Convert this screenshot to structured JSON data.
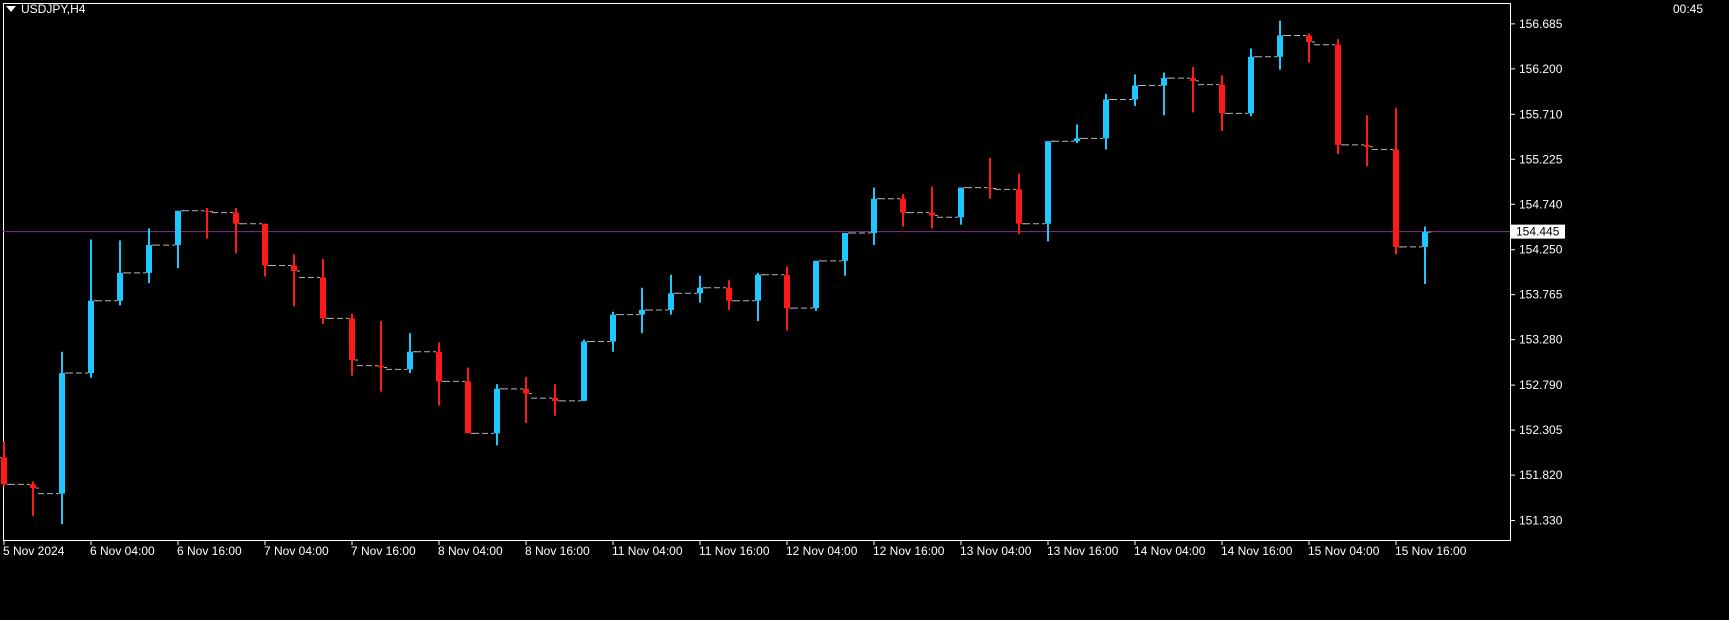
{
  "header": {
    "symbol": "USDJPY,H4",
    "clock": "00:45"
  },
  "colors": {
    "background": "#000000",
    "frame": "#ffffff",
    "bull": "#1ec8ff",
    "bear": "#ff1a1a",
    "bid_line": "#8b2c93",
    "bid_tag_bg": "#ffffff",
    "bid_tag_text": "#000000",
    "open_close_tick": "#b4b4b4"
  },
  "icons": {
    "symbol_menu": "triangle-down-icon"
  },
  "chart_data": {
    "type": "ohlc-candlestick",
    "title": "USDJPY,H4",
    "ylim": [
      151.12,
      156.91
    ],
    "y_ticks": [
      "156.685",
      "156.200",
      "155.710",
      "155.225",
      "154.740",
      "154.250",
      "153.765",
      "153.280",
      "152.790",
      "152.305",
      "151.820",
      "151.330"
    ],
    "x_ticks": [
      "5 Nov 2024",
      "6 Nov 04:00",
      "6 Nov 16:00",
      "7 Nov 04:00",
      "7 Nov 16:00",
      "8 Nov 04:00",
      "8 Nov 16:00",
      "11 Nov 04:00",
      "11 Nov 16:00",
      "12 Nov 04:00",
      "12 Nov 16:00",
      "13 Nov 04:00",
      "13 Nov 16:00",
      "14 Nov 04:00",
      "14 Nov 16:00",
      "15 Nov 04:00",
      "15 Nov 16:00"
    ],
    "current_price": "154.445",
    "current_price_value": 154.445,
    "candles": [
      {
        "o": 152.01,
        "h": 152.18,
        "l": 151.7,
        "c": 151.72
      },
      {
        "o": 151.72,
        "h": 151.75,
        "l": 151.38,
        "c": 151.68
      },
      {
        "o": 151.62,
        "h": 153.15,
        "l": 151.29,
        "c": 152.92
      },
      {
        "o": 152.92,
        "h": 154.36,
        "l": 152.87,
        "c": 153.7
      },
      {
        "o": 153.7,
        "h": 154.35,
        "l": 153.65,
        "c": 154.0
      },
      {
        "o": 154.0,
        "h": 154.48,
        "l": 153.89,
        "c": 154.3
      },
      {
        "o": 154.3,
        "h": 154.67,
        "l": 154.05,
        "c": 154.67
      },
      {
        "o": 154.67,
        "h": 154.7,
        "l": 154.37,
        "c": 154.66
      },
      {
        "o": 154.65,
        "h": 154.7,
        "l": 154.21,
        "c": 154.53
      },
      {
        "o": 154.53,
        "h": 154.53,
        "l": 153.96,
        "c": 154.08
      },
      {
        "o": 154.08,
        "h": 154.2,
        "l": 153.64,
        "c": 154.02
      },
      {
        "o": 153.95,
        "h": 154.15,
        "l": 153.45,
        "c": 153.51
      },
      {
        "o": 153.51,
        "h": 153.56,
        "l": 152.89,
        "c": 153.06
      },
      {
        "o": 153.0,
        "h": 153.48,
        "l": 152.72,
        "c": 152.98
      },
      {
        "o": 152.96,
        "h": 153.35,
        "l": 152.92,
        "c": 153.15
      },
      {
        "o": 153.15,
        "h": 153.25,
        "l": 152.57,
        "c": 152.83
      },
      {
        "o": 152.83,
        "h": 152.98,
        "l": 152.3,
        "c": 152.27
      },
      {
        "o": 152.27,
        "h": 152.8,
        "l": 152.14,
        "c": 152.75
      },
      {
        "o": 152.75,
        "h": 152.88,
        "l": 152.38,
        "c": 152.7
      },
      {
        "o": 152.65,
        "h": 152.8,
        "l": 152.46,
        "c": 152.62
      },
      {
        "o": 152.62,
        "h": 153.28,
        "l": 152.62,
        "c": 153.26
      },
      {
        "o": 153.26,
        "h": 153.58,
        "l": 153.15,
        "c": 153.55
      },
      {
        "o": 153.55,
        "h": 153.84,
        "l": 153.35,
        "c": 153.6
      },
      {
        "o": 153.6,
        "h": 153.98,
        "l": 153.55,
        "c": 153.78
      },
      {
        "o": 153.78,
        "h": 153.97,
        "l": 153.68,
        "c": 153.84
      },
      {
        "o": 153.84,
        "h": 153.92,
        "l": 153.6,
        "c": 153.7
      },
      {
        "o": 153.7,
        "h": 154.0,
        "l": 153.48,
        "c": 153.98
      },
      {
        "o": 153.98,
        "h": 154.07,
        "l": 153.38,
        "c": 153.62
      },
      {
        "o": 153.62,
        "h": 154.13,
        "l": 153.59,
        "c": 154.13
      },
      {
        "o": 154.13,
        "h": 154.4,
        "l": 153.97,
        "c": 154.43
      },
      {
        "o": 154.43,
        "h": 154.92,
        "l": 154.3,
        "c": 154.8
      },
      {
        "o": 154.8,
        "h": 154.85,
        "l": 154.5,
        "c": 154.65
      },
      {
        "o": 154.65,
        "h": 154.93,
        "l": 154.48,
        "c": 154.62
      },
      {
        "o": 154.6,
        "h": 154.92,
        "l": 154.52,
        "c": 154.92
      },
      {
        "o": 154.92,
        "h": 155.24,
        "l": 154.8,
        "c": 154.91
      },
      {
        "o": 154.9,
        "h": 155.07,
        "l": 154.42,
        "c": 154.53
      },
      {
        "o": 154.53,
        "h": 155.42,
        "l": 154.34,
        "c": 155.42
      },
      {
        "o": 155.42,
        "h": 155.6,
        "l": 155.4,
        "c": 155.45
      },
      {
        "o": 155.45,
        "h": 155.93,
        "l": 155.33,
        "c": 155.87
      },
      {
        "o": 155.87,
        "h": 156.14,
        "l": 155.8,
        "c": 156.02
      },
      {
        "o": 156.02,
        "h": 156.16,
        "l": 155.7,
        "c": 156.1
      },
      {
        "o": 156.1,
        "h": 156.22,
        "l": 155.73,
        "c": 156.07
      },
      {
        "o": 156.03,
        "h": 156.13,
        "l": 155.53,
        "c": 155.72
      },
      {
        "o": 155.72,
        "h": 156.42,
        "l": 155.69,
        "c": 156.33
      },
      {
        "o": 156.33,
        "h": 156.72,
        "l": 156.19,
        "c": 156.56
      },
      {
        "o": 156.56,
        "h": 156.58,
        "l": 156.27,
        "c": 156.49
      },
      {
        "o": 156.46,
        "h": 156.52,
        "l": 155.28,
        "c": 155.38
      },
      {
        "o": 155.38,
        "h": 155.7,
        "l": 155.15,
        "c": 155.36
      },
      {
        "o": 155.33,
        "h": 155.78,
        "l": 154.2,
        "c": 154.28
      },
      {
        "o": 154.28,
        "h": 154.5,
        "l": 153.88,
        "c": 154.44
      }
    ]
  }
}
